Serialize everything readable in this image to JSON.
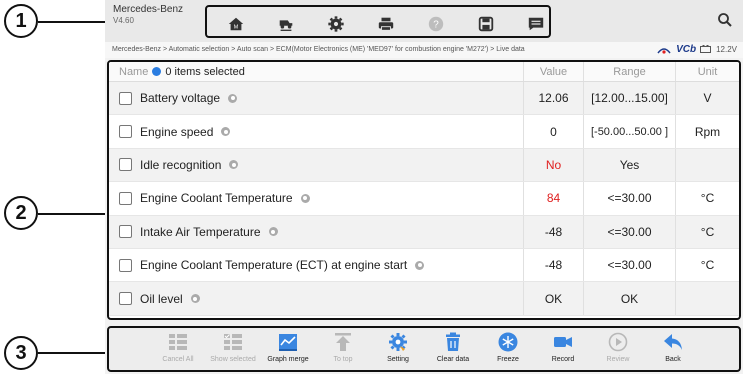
{
  "callouts": [
    "1",
    "2",
    "3"
  ],
  "brand": {
    "name": "Mercedes-Benz",
    "version": "V4.60"
  },
  "toolbar": {
    "icons": [
      "home-icon",
      "vehicle-swap-icon",
      "settings-icon",
      "print-icon",
      "help-icon",
      "save-icon",
      "message-icon"
    ]
  },
  "breadcrumb": "Mercedes-Benz > Automatic selection > Auto scan > ECM(Motor Electronics (ME) 'MED97' for combustion engine 'M272') > Live data",
  "vci": {
    "brand": "VCb",
    "voltage": "12.2V"
  },
  "table": {
    "header": {
      "name": "Name",
      "selected": "0 items selected",
      "value": "Value",
      "range": "Range",
      "unit": "Unit"
    },
    "rows": [
      {
        "name": "Battery voltage",
        "value": "12.06",
        "range": "[12.00...15.00]",
        "unit": "V",
        "alert": false
      },
      {
        "name": "Engine speed",
        "value": "0",
        "range": "[-50.00...50.00 ]",
        "unit": "Rpm",
        "alert": false
      },
      {
        "name": "Idle recognition",
        "value": "No",
        "range": "Yes",
        "unit": "",
        "alert": true
      },
      {
        "name": "Engine Coolant Temperature",
        "value": "84",
        "range": "<=30.00",
        "unit": "°C",
        "alert": true
      },
      {
        "name": "Intake Air Temperature",
        "value": "-48",
        "range": "<=30.00",
        "unit": "°C",
        "alert": false
      },
      {
        "name": "Engine Coolant Temperature (ECT) at engine start",
        "value": "-48",
        "range": "<=30.00",
        "unit": "°C",
        "alert": false
      },
      {
        "name": "Oil level",
        "value": "OK",
        "range": "OK",
        "unit": "",
        "alert": false
      }
    ]
  },
  "bottom": {
    "buttons": [
      {
        "label": "Cancel All",
        "icon": "cancel-all-icon",
        "enabled": false
      },
      {
        "label": "Show selected",
        "icon": "show-selected-icon",
        "enabled": false
      },
      {
        "label": "Graph merge",
        "icon": "graph-merge-icon",
        "enabled": true
      },
      {
        "label": "To top",
        "icon": "to-top-icon",
        "enabled": false
      },
      {
        "label": "Setting",
        "icon": "setting-icon",
        "enabled": true
      },
      {
        "label": "Clear data",
        "icon": "clear-data-icon",
        "enabled": true
      },
      {
        "label": "Freeze",
        "icon": "freeze-icon",
        "enabled": true
      },
      {
        "label": "Record",
        "icon": "record-icon",
        "enabled": true
      },
      {
        "label": "Review",
        "icon": "review-icon",
        "enabled": false
      },
      {
        "label": "Back",
        "icon": "back-icon",
        "enabled": true
      }
    ]
  },
  "colors": {
    "accent": "#2a7de1",
    "alert": "#e02020",
    "frame": "#111111"
  }
}
